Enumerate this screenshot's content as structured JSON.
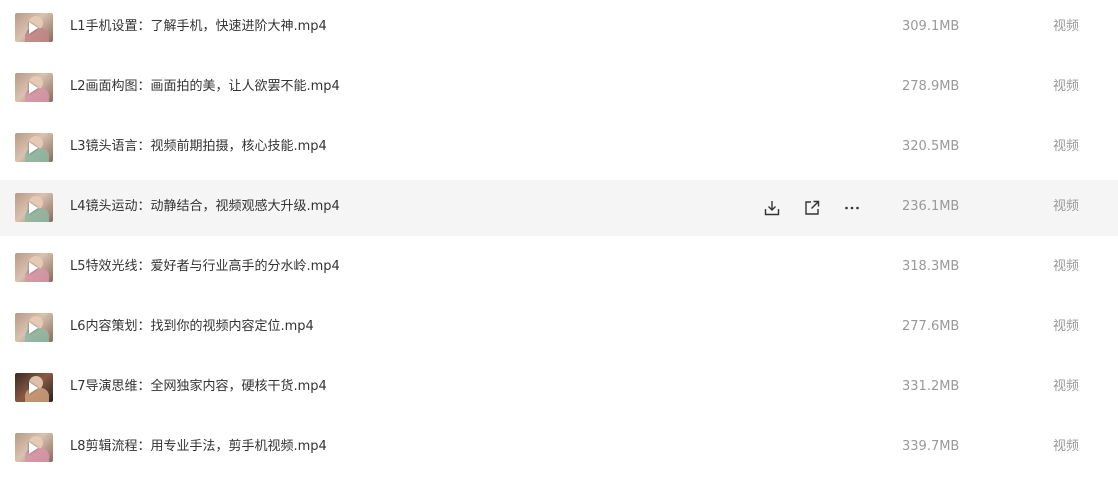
{
  "files": [
    {
      "name": "L1手机设置：了解手机，快速进阶大神.mp4",
      "size": "309.1MB",
      "type": "视频"
    },
    {
      "name": "L2画面构图：画面拍的美，让人欲罢不能.mp4",
      "size": "278.9MB",
      "type": "视频"
    },
    {
      "name": "L3镜头语言：视频前期拍摄，核心技能.mp4",
      "size": "320.5MB",
      "type": "视频"
    },
    {
      "name": "L4镜头运动：动静结合，视频观感大升级.mp4",
      "size": "236.1MB",
      "type": "视频"
    },
    {
      "name": "L5特效光线：爱好者与行业高手的分水岭.mp4",
      "size": "318.3MB",
      "type": "视频"
    },
    {
      "name": "L6内容策划：找到你的视频内容定位.mp4",
      "size": "277.6MB",
      "type": "视频"
    },
    {
      "name": "L7导演思维：全网独家内容，硬核干货.mp4",
      "size": "331.2MB",
      "type": "视频"
    },
    {
      "name": "L8剪辑流程：用专业手法，剪手机视频.mp4",
      "size": "339.7MB",
      "type": "视频"
    }
  ],
  "row_actions": {
    "download_icon": "download-icon",
    "share_icon": "share-icon",
    "more_icon": "more-icon"
  },
  "colors": {
    "hover_row": "#f5f5f6",
    "name_text": "#333333",
    "meta_text": "#999999"
  }
}
